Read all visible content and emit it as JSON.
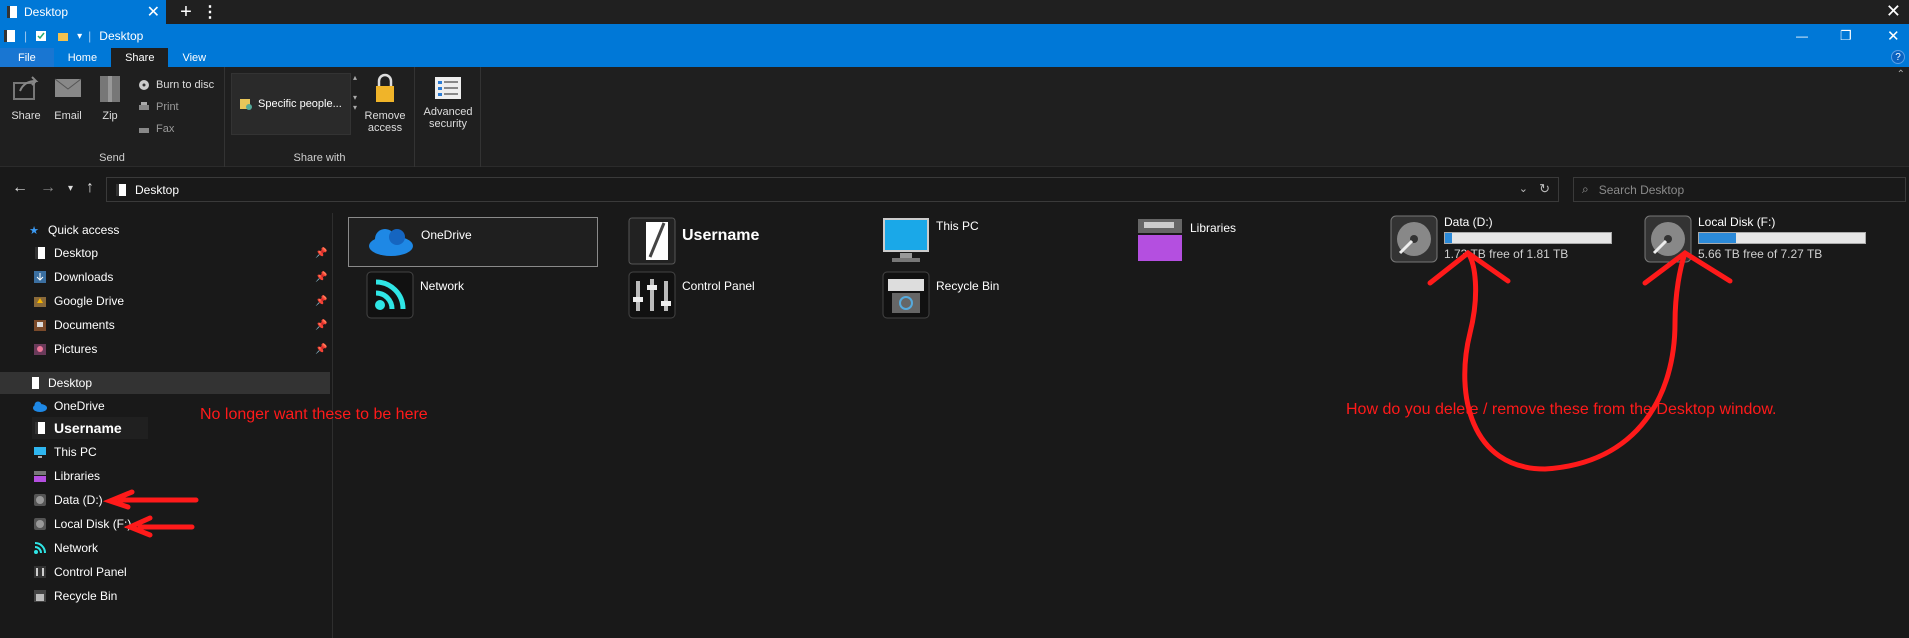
{
  "tabbar": {
    "tab_title": "Desktop",
    "new_tab": "+",
    "more": "⋮",
    "close": "✕"
  },
  "titlebar": {
    "title": "Desktop"
  },
  "window_controls": {
    "minimize": "—",
    "restore": "❐",
    "close": "✕"
  },
  "ribbon_tabs": {
    "file": "File",
    "home": "Home",
    "share": "Share",
    "view": "View",
    "help": "?"
  },
  "ribbon": {
    "send_group": "Send",
    "share_group": "Share with",
    "share": "Share",
    "email": "Email",
    "zip": "Zip",
    "burn": "Burn to disc",
    "print": "Print",
    "fax": "Fax",
    "specific_people": "Specific people...",
    "remove_access": "Remove access",
    "advanced_security": "Advanced security"
  },
  "address": {
    "path": "Desktop",
    "search_placeholder": "Search Desktop"
  },
  "nav": {
    "quick_access": "Quick access",
    "quick_items": [
      "Desktop",
      "Downloads",
      "Google Drive",
      "Documents",
      "Pictures"
    ],
    "desktop": "Desktop",
    "desktop_items": [
      "OneDrive",
      "Username",
      "This PC",
      "Libraries",
      "Data (D:)",
      "Local Disk (F:)",
      "Network",
      "Control Panel",
      "Recycle Bin"
    ]
  },
  "content": {
    "onedrive": "OneDrive",
    "username": "Username",
    "thispc": "This PC",
    "libraries": "Libraries",
    "network": "Network",
    "control_panel": "Control Panel",
    "recycle_bin": "Recycle Bin",
    "drive_d": {
      "name": "Data (D:)",
      "free": "1.73 TB free of 1.81 TB",
      "used_fraction": 0.04
    },
    "drive_f": {
      "name": "Local Disk (F:)",
      "free": "5.66 TB free of 7.27 TB",
      "used_fraction": 0.22
    }
  },
  "annotations": {
    "left": "No longer want these to be here",
    "right": "How do you delete / remove these from the Desktop window."
  },
  "colors": {
    "accent": "#0078d7",
    "annotation": "#ff1a1a",
    "background": "#191919"
  }
}
